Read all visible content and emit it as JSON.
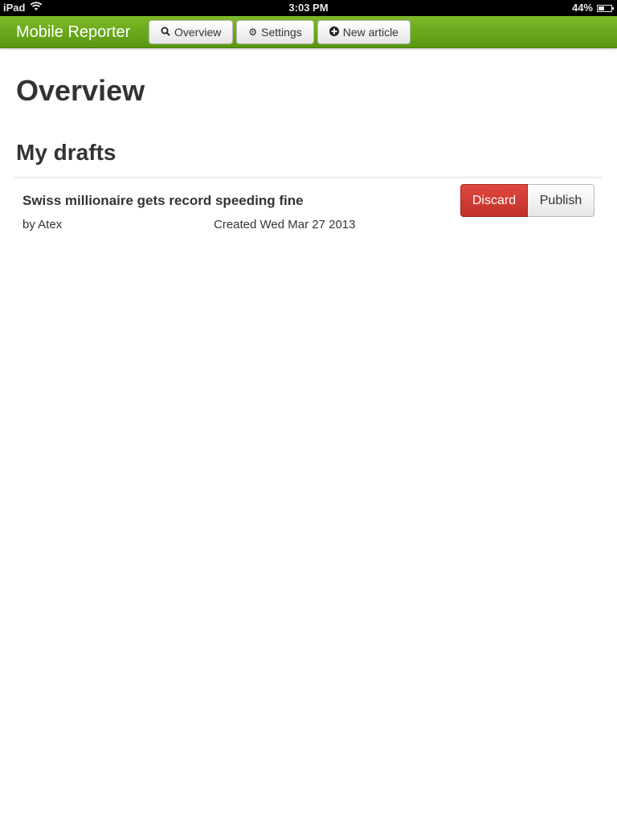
{
  "statusbar": {
    "device": "iPad",
    "time": "3:03 PM",
    "battery_percent": "44%",
    "battery_level": 0.44
  },
  "navbar": {
    "brand": "Mobile Reporter",
    "buttons": [
      {
        "label": "Overview",
        "icon": "search-icon"
      },
      {
        "label": "Settings",
        "icon": "gear-icon"
      },
      {
        "label": "New article",
        "icon": "plus-circle-icon"
      }
    ],
    "color": "#6aa81c"
  },
  "page": {
    "title": "Overview",
    "section_title": "My drafts"
  },
  "drafts": [
    {
      "title": "Swiss millionaire gets record speeding fine",
      "author": "by Atex",
      "created": "Created Wed Mar 27 2013",
      "discard_label": "Discard",
      "publish_label": "Publish"
    }
  ],
  "colors": {
    "discard": "#d33a32",
    "accent_green": "#6aa81c"
  }
}
